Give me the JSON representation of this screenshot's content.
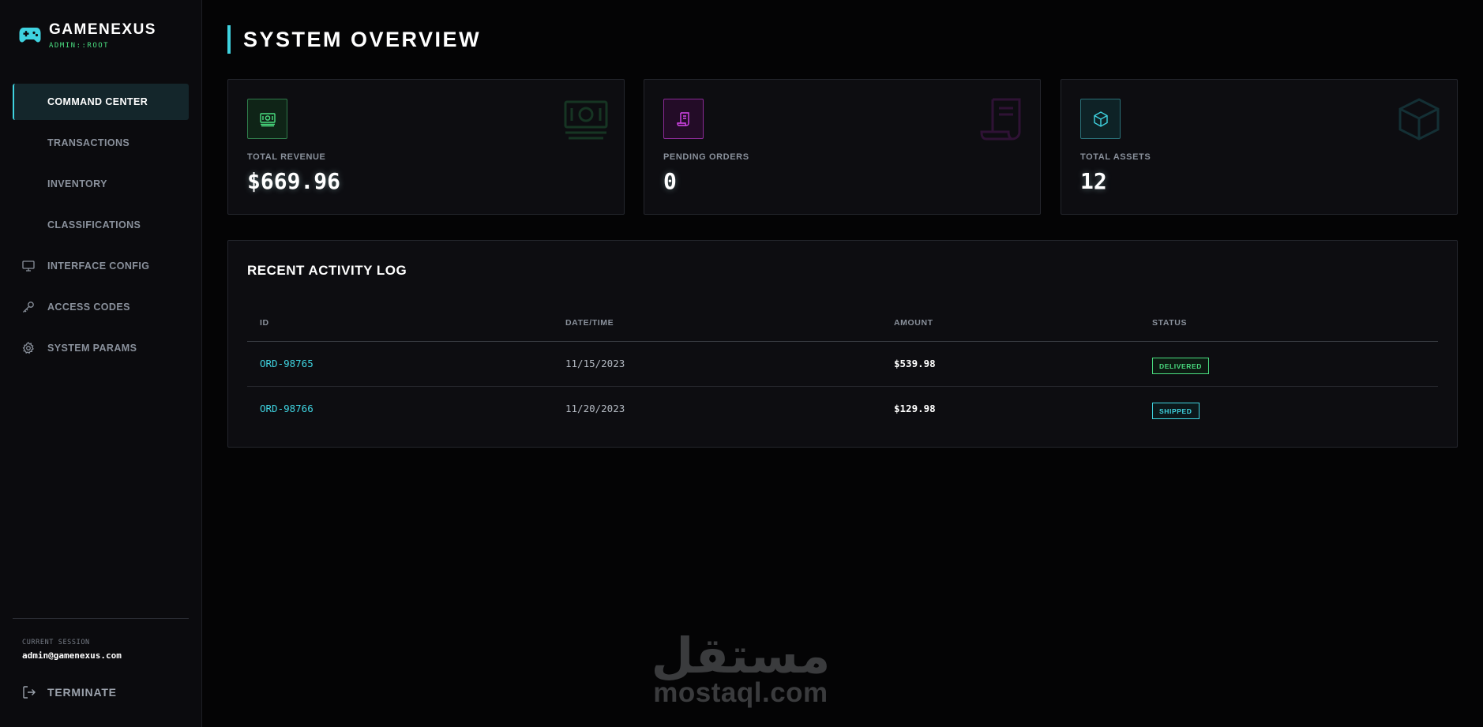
{
  "brand": {
    "name": "GAMENEXUS",
    "role": "ADMIN::ROOT",
    "icon": "gamepad-icon"
  },
  "nav": [
    {
      "label": "COMMAND CENTER",
      "active": true,
      "icon": ""
    },
    {
      "label": "TRANSACTIONS",
      "active": false,
      "icon": ""
    },
    {
      "label": "INVENTORY",
      "active": false,
      "icon": ""
    },
    {
      "label": "CLASSIFICATIONS",
      "active": false,
      "icon": ""
    },
    {
      "label": "INTERFACE CONFIG",
      "active": false,
      "icon": "monitor-icon"
    },
    {
      "label": "ACCESS CODES",
      "active": false,
      "icon": "key-icon"
    },
    {
      "label": "SYSTEM PARAMS",
      "active": false,
      "icon": "gear-icon"
    }
  ],
  "session": {
    "label": "CURRENT SESSION",
    "email": "admin@gamenexus.com"
  },
  "terminate": {
    "label": "TERMINATE",
    "icon": "logout-icon"
  },
  "page": {
    "title": "SYSTEM OVERVIEW"
  },
  "stats": [
    {
      "label": "TOTAL REVENUE",
      "value": "$669.96",
      "icon": "cash-icon",
      "color": "#4ade80"
    },
    {
      "label": "PENDING ORDERS",
      "value": "0",
      "icon": "receipt-icon",
      "color": "#d946ef"
    },
    {
      "label": "TOTAL ASSETS",
      "value": "12",
      "icon": "cube-icon",
      "color": "#3fd3e0"
    }
  ],
  "activity": {
    "title": "RECENT ACTIVITY LOG",
    "columns": [
      "ID",
      "DATE/TIME",
      "AMOUNT",
      "STATUS"
    ],
    "rows": [
      {
        "id": "ORD-98765",
        "date": "11/15/2023",
        "amount": "$539.98",
        "status": "DELIVERED"
      },
      {
        "id": "ORD-98766",
        "date": "11/20/2023",
        "amount": "$129.98",
        "status": "SHIPPED"
      }
    ]
  },
  "watermark": {
    "arabic": "مستقل",
    "latin": "mostaql.com"
  },
  "colors": {
    "accent": "#3fd3e0",
    "success": "#4ade80",
    "magenta": "#d946ef",
    "background": "#040405"
  }
}
